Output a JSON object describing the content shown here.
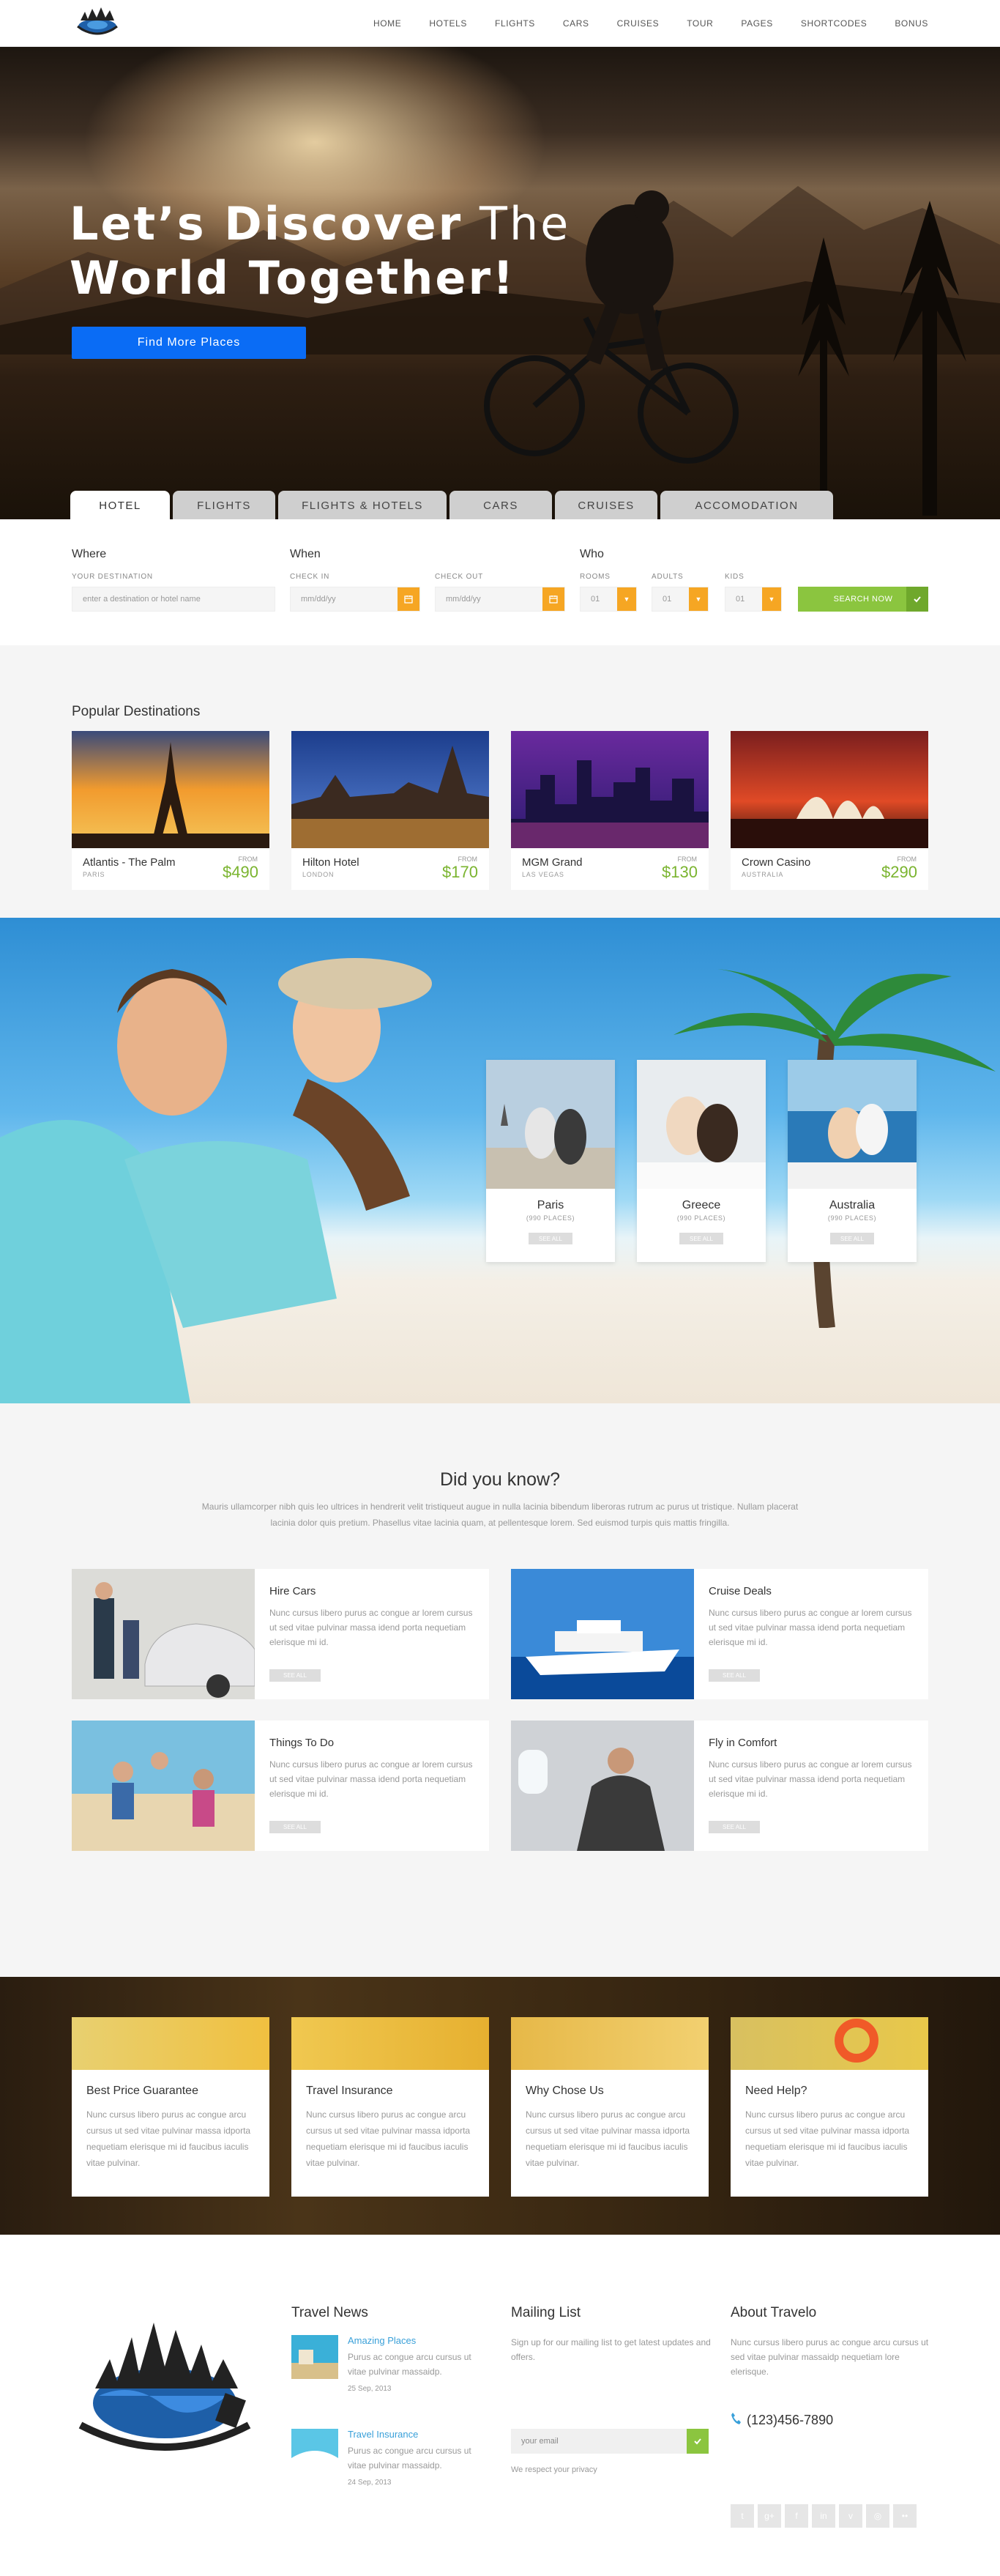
{
  "nav": {
    "items": [
      "HOME",
      "HOTELS",
      "FLIGHTS",
      "CARS",
      "CRUISES",
      "TOUR",
      "PAGES",
      "SHORTCODES",
      "BONUS"
    ]
  },
  "hero": {
    "title_bold_1": "Let’s Discover",
    "title_light_1": " The",
    "title_line_2": "World Together!",
    "button": "Find More Places"
  },
  "tabs": [
    "HOTEL",
    "FLIGHTS",
    "FLIGHTS & HOTELS",
    "CARS",
    "CRUISES",
    "ACCOMODATION"
  ],
  "search": {
    "where_label": "Where",
    "where_sub": "YOUR DESTINATION",
    "where_placeholder": "enter a destination or hotel name",
    "when_label": "When",
    "checkin_sub": "CHECK IN",
    "checkout_sub": "CHECK OUT",
    "date_placeholder": "mm/dd/yy",
    "who_label": "Who",
    "rooms_sub": "ROOMS",
    "adults_sub": "ADULTS",
    "kids_sub": "KIDS",
    "rooms_value": "01",
    "adults_value": "01",
    "kids_value": "01",
    "button": "SEARCH NOW"
  },
  "popular": {
    "title": "Popular Destinations",
    "items": [
      {
        "name": "Atlantis - The Palm",
        "city": "PARIS",
        "from": "FROM",
        "price": "$490"
      },
      {
        "name": "Hilton Hotel",
        "city": "LONDON",
        "from": "FROM",
        "price": "$170"
      },
      {
        "name": "MGM Grand",
        "city": "LAS VEGAS",
        "from": "FROM",
        "price": "$130"
      },
      {
        "name": "Crown Casino",
        "city": "AUSTRALIA",
        "from": "FROM",
        "price": "$290"
      }
    ]
  },
  "cities": [
    {
      "name": "Paris",
      "places": "(990 PLACES)",
      "see": "SEE ALL"
    },
    {
      "name": "Greece",
      "places": "(990 PLACES)",
      "see": "SEE ALL"
    },
    {
      "name": "Australia",
      "places": "(990 PLACES)",
      "see": "SEE ALL"
    }
  ],
  "know": {
    "title": "Did you know?",
    "intro": "Mauris ullamcorper nibh quis leo ultrices in hendrerit velit tristiqueut augue in nulla lacinia bibendum liberoras rutrum ac purus ut tristique. Nullam placerat lacinia dolor quis pretium. Phasellus vitae lacinia quam, at pellentesque lorem. Sed euismod turpis quis mattis fringilla.",
    "items": [
      {
        "title": "Hire Cars",
        "text": "Nunc cursus libero purus ac congue ar lorem cursus ut sed vitae pulvinar massa idend porta nequetiam elerisque mi id.",
        "see": "SEE ALL"
      },
      {
        "title": "Cruise Deals",
        "text": "Nunc cursus libero purus ac congue ar lorem cursus ut sed vitae pulvinar massa idend porta nequetiam elerisque mi id.",
        "see": "SEE ALL"
      },
      {
        "title": "Things To Do",
        "text": "Nunc cursus libero purus ac congue ar lorem cursus ut sed vitae pulvinar massa idend porta nequetiam elerisque mi id.",
        "see": "SEE ALL"
      },
      {
        "title": "Fly in Comfort",
        "text": "Nunc cursus libero purus ac congue ar lorem cursus ut sed vitae pulvinar massa idend porta nequetiam elerisque mi id.",
        "see": "SEE ALL"
      }
    ]
  },
  "why": [
    {
      "title": "Best Price Guarantee",
      "text": "Nunc cursus libero purus ac congue arcu cursus ut sed vitae pulvinar massa idporta nequetiam elerisque mi id faucibus iaculis vitae pulvinar."
    },
    {
      "title": "Travel Insurance",
      "text": "Nunc cursus libero purus ac congue arcu cursus ut sed vitae pulvinar massa idporta nequetiam elerisque mi id faucibus iaculis vitae pulvinar."
    },
    {
      "title": "Why Chose Us",
      "text": "Nunc cursus libero purus ac congue arcu cursus ut sed vitae pulvinar massa idporta nequetiam elerisque mi id faucibus iaculis vitae pulvinar."
    },
    {
      "title": "Need Help?",
      "text": "Nunc cursus libero purus ac congue arcu cursus ut sed vitae pulvinar massa idporta nequetiam elerisque mi id faucibus iaculis vitae pulvinar."
    }
  ],
  "footer": {
    "news_title": "Travel News",
    "news": [
      {
        "title": "Amazing Places",
        "text": "Purus ac congue arcu cursus ut vitae pulvinar massaidp.",
        "date": "25 Sep, 2013"
      },
      {
        "title": "Travel Insurance",
        "text": "Purus ac congue arcu cursus ut vitae pulvinar massaidp.",
        "date": "24 Sep, 2013"
      }
    ],
    "mailing_title": "Mailing List",
    "mailing_text": "Sign up for our mailing list to get latest updates and offers.",
    "email_placeholder": "your email",
    "privacy": "We respect your privacy",
    "about_title": "About Travelo",
    "about_text": "Nunc cursus libero purus ac congue arcu cursus ut sed vitae pulvinar massaidp nequetiam lore elerisque.",
    "phone": "(123)456-7890",
    "social": [
      "twitter-icon",
      "google-plus-icon",
      "facebook-icon",
      "linkedin-icon",
      "vimeo-icon",
      "dribbble-icon",
      "flickr-icon"
    ]
  },
  "colors": {
    "primary_blue": "#0a6cf5",
    "accent_orange": "#f6a623",
    "accent_green": "#8bc53f",
    "price_green": "#7ab42f",
    "link_blue": "#39a0d9"
  }
}
